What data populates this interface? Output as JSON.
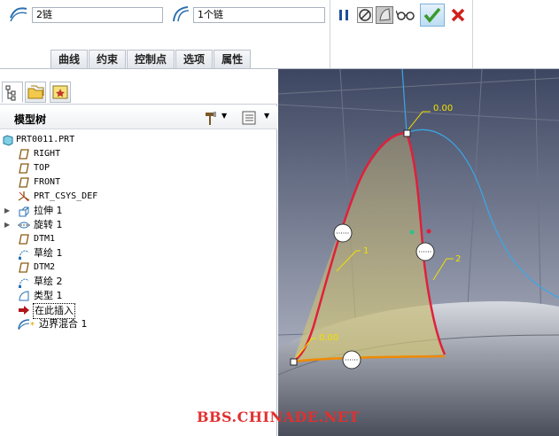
{
  "dashboard": {
    "chain_field_1": "2链",
    "chain_field_2": "1个链",
    "tabs": [
      "曲线",
      "约束",
      "控制点",
      "选项",
      "属性"
    ]
  },
  "model_tree": {
    "title": "模型树",
    "items": [
      {
        "label": "PRT0011.PRT",
        "icon": "part-icon"
      },
      {
        "label": "RIGHT",
        "icon": "datum-plane-icon"
      },
      {
        "label": "TOP",
        "icon": "datum-plane-icon"
      },
      {
        "label": "FRONT",
        "icon": "datum-plane-icon"
      },
      {
        "label": "PRT_CSYS_DEF",
        "icon": "csys-icon"
      },
      {
        "label": "拉伸 1",
        "icon": "extrude-icon"
      },
      {
        "label": "旋转 1",
        "icon": "revolve-icon"
      },
      {
        "label": "DTM1",
        "icon": "datum-plane-icon"
      },
      {
        "label": "草绘 1",
        "icon": "sketch-icon"
      },
      {
        "label": "DTM2",
        "icon": "datum-plane-icon"
      },
      {
        "label": "草绘 2",
        "icon": "sketch-icon"
      },
      {
        "label": "类型 1",
        "icon": "surface-icon"
      },
      {
        "label": "在此插入",
        "icon": "insert-arrow-icon"
      },
      {
        "label": "边界混合 1",
        "icon": "boundary-blend-icon"
      }
    ]
  },
  "viewport": {
    "label_top": "0.00",
    "label_bottom": "0.00",
    "curve_label_1": "1",
    "curve_label_2": "2",
    "watermark": "BBS.CHINADE.NET"
  },
  "colors": {
    "accent_green": "#3a9a2c",
    "cancel_red": "#d0201c",
    "curve_red": "#e0203a",
    "curve_orange": "#f08a00",
    "viewport_bg": "#3e4862"
  }
}
